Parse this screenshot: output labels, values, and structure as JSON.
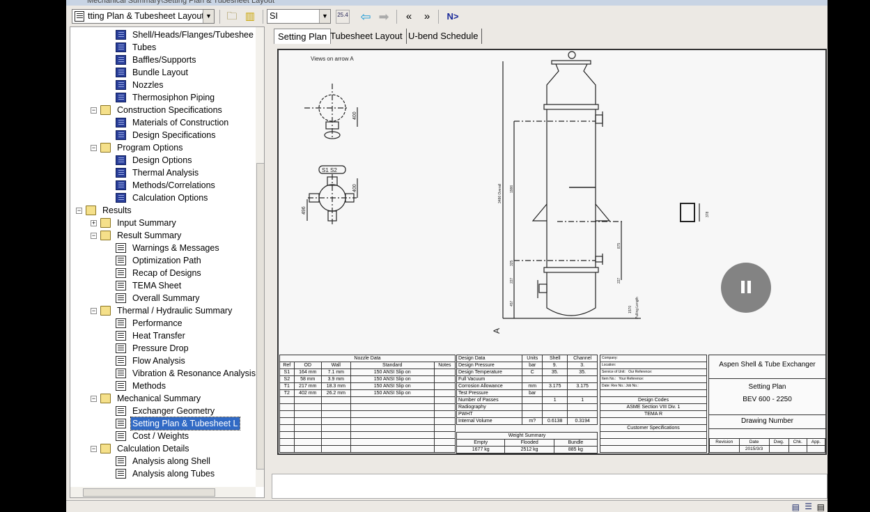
{
  "window": {
    "title": "Mechanical Summary\\Setting Plan & Tubesheet Layout"
  },
  "toolbar": {
    "form_combo": "tting Plan & Tubesheet Layout",
    "units_combo": "SI",
    "units_icon_text": "25.4",
    "nav_next_label": "N>"
  },
  "tree": {
    "items": [
      {
        "label": "Shell/Heads/Flanges/Tubeshee",
        "level": 3,
        "icon": "book"
      },
      {
        "label": "Tubes",
        "level": 3,
        "icon": "book"
      },
      {
        "label": "Baffles/Supports",
        "level": 3,
        "icon": "book"
      },
      {
        "label": "Bundle Layout",
        "level": 3,
        "icon": "book"
      },
      {
        "label": "Nozzles",
        "level": 3,
        "icon": "book"
      },
      {
        "label": "Thermosiphon Piping",
        "level": 3,
        "icon": "book"
      },
      {
        "label": "Construction Specifications",
        "level": 2,
        "icon": "folder",
        "exp": "-"
      },
      {
        "label": "Materials of Construction",
        "level": 3,
        "icon": "book"
      },
      {
        "label": "Design Specifications",
        "level": 3,
        "icon": "book"
      },
      {
        "label": "Program Options",
        "level": 2,
        "icon": "folder",
        "exp": "-"
      },
      {
        "label": "Design Options",
        "level": 3,
        "icon": "book"
      },
      {
        "label": "Thermal Analysis",
        "level": 3,
        "icon": "book"
      },
      {
        "label": "Methods/Correlations",
        "level": 3,
        "icon": "book"
      },
      {
        "label": "Calculation Options",
        "level": 3,
        "icon": "book"
      },
      {
        "label": "Results",
        "level": 1,
        "icon": "folder",
        "exp": "-"
      },
      {
        "label": "Input Summary",
        "level": 2,
        "icon": "folder",
        "exp": "+"
      },
      {
        "label": "Result Summary",
        "level": 2,
        "icon": "folder",
        "exp": "-"
      },
      {
        "label": "Warnings & Messages",
        "level": 3,
        "icon": "page"
      },
      {
        "label": "Optimization Path",
        "level": 3,
        "icon": "page"
      },
      {
        "label": "Recap of Designs",
        "level": 3,
        "icon": "page"
      },
      {
        "label": "TEMA Sheet",
        "level": 3,
        "icon": "page"
      },
      {
        "label": "Overall Summary",
        "level": 3,
        "icon": "page"
      },
      {
        "label": "Thermal / Hydraulic Summary",
        "level": 2,
        "icon": "folder",
        "exp": "-"
      },
      {
        "label": "Performance",
        "level": 3,
        "icon": "page"
      },
      {
        "label": "Heat Transfer",
        "level": 3,
        "icon": "page"
      },
      {
        "label": "Pressure Drop",
        "level": 3,
        "icon": "page"
      },
      {
        "label": "Flow Analysis",
        "level": 3,
        "icon": "page"
      },
      {
        "label": "Vibration & Resonance Analysis",
        "level": 3,
        "icon": "page"
      },
      {
        "label": "Methods",
        "level": 3,
        "icon": "page"
      },
      {
        "label": "Mechanical Summary",
        "level": 2,
        "icon": "folder",
        "exp": "-"
      },
      {
        "label": "Exchanger Geometry",
        "level": 3,
        "icon": "page"
      },
      {
        "label": "Setting Plan & Tubesheet L",
        "level": 3,
        "icon": "page",
        "selected": true
      },
      {
        "label": "Cost / Weights",
        "level": 3,
        "icon": "page"
      },
      {
        "label": "Calculation Details",
        "level": 2,
        "icon": "folder",
        "exp": "-"
      },
      {
        "label": "Analysis along Shell",
        "level": 3,
        "icon": "page"
      },
      {
        "label": "Analysis along Tubes",
        "level": 3,
        "icon": "page"
      }
    ]
  },
  "tabs": [
    {
      "label": "Setting Plan",
      "active": true
    },
    {
      "label": "Tubesheet Layout"
    },
    {
      "label": "U-bend Schedule"
    }
  ],
  "drawing": {
    "views_label": "Views on arrow A",
    "t1_tag": "T1",
    "s_tag": "S1 S2",
    "dim_400a": "400",
    "dim_400b": "400",
    "dim_496": "496",
    "overall": "3486 Overall",
    "dim_1986": "1986",
    "dim_875": "875",
    "dim_325": "325",
    "dim_227a": "227",
    "dim_227b": "227",
    "dim_457": "457",
    "pulling": "Pulling Length",
    "dim_1570": "1570",
    "arrow_a": "A",
    "side_dim": "378",
    "nozzle_labels": [
      "T2",
      "S1",
      "S2",
      "T1"
    ]
  },
  "nozzle_table": {
    "title": "Nozzle Data",
    "headers": [
      "Ref",
      "OD",
      "Wall",
      "Standard",
      "Notes"
    ],
    "rows": [
      [
        "S1",
        "164 mm",
        "7.1 mm",
        "150 ANSI  Slip on",
        ""
      ],
      [
        "S2",
        "58 mm",
        "3.9 mm",
        "150 ANSI  Slip on",
        ""
      ],
      [
        "T1",
        "217 mm",
        "18.3 mm",
        "150 ANSI  Slip on",
        ""
      ],
      [
        "T2",
        "402 mm",
        "26.2 mm",
        "150 ANSI  Slip on",
        ""
      ]
    ]
  },
  "design_table": {
    "headers": [
      "Design Data",
      "Units",
      "Shell",
      "Channel"
    ],
    "rows": [
      [
        "Design Pressure",
        "bar",
        "9.",
        "3."
      ],
      [
        "Design Temperature",
        "C",
        "35.",
        "35."
      ],
      [
        "Full Vacuum",
        "",
        "",
        ""
      ],
      [
        "Corrosion Allowance",
        "mm",
        "3.175",
        "3.175"
      ],
      [
        "Test Pressure",
        "bar",
        "",
        ""
      ],
      [
        "Number of Passes",
        "",
        "1",
        "1"
      ],
      [
        "Radiography",
        "",
        "",
        ""
      ],
      [
        "PWHT",
        "",
        "",
        ""
      ],
      [
        "Internal Volume",
        "m?",
        "0.6138",
        "0.3194"
      ]
    ]
  },
  "weight_table": {
    "title": "Weight Summary",
    "headers": [
      "Empty",
      "Flooded",
      "Bundle"
    ],
    "values": [
      "1677 kg",
      "2512 kg",
      "885 kg"
    ]
  },
  "info_table": {
    "company": "Company:",
    "location": "Location:",
    "service": "Service of Unit:",
    "our_ref": "Our Reference:",
    "item": "Item No.:",
    "your_ref": "Your Reference:",
    "date": "Date:",
    "rev": "Rev No.:",
    "job": "Job No.:",
    "design_codes": "Design Codes",
    "code1": "ASME Section VIII Div. 1",
    "code2": "TEMA R",
    "customer_specs": "Customer Specifications"
  },
  "title_block": {
    "company": "Aspen Shell & Tube Exchanger",
    "drawing_title": "Setting Plan",
    "model": "BEV  600 -  2250",
    "drawing_number": "Drawing Number",
    "rev_headers": [
      "Revision",
      "Date",
      "Dwg.",
      "Chk.",
      "App."
    ],
    "date": "2015/3/3"
  }
}
